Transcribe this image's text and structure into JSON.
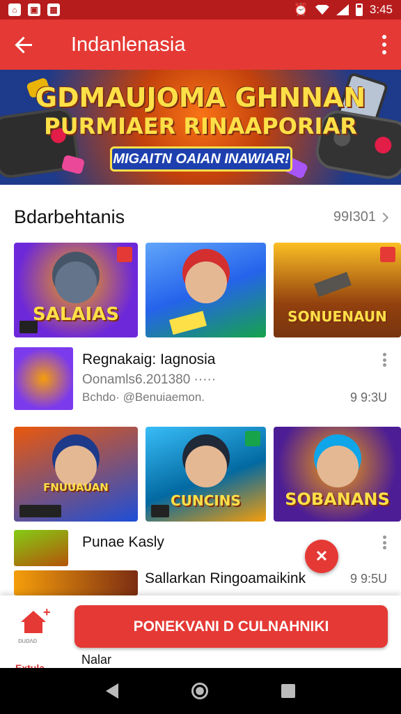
{
  "status_bar": {
    "time": "3:45"
  },
  "app_bar": {
    "title": "Indanlenasia"
  },
  "banner": {
    "line1": "GDMAUJOMA GHNNAN",
    "line2": "PURMIAER RINAAPORIAR",
    "pill": "MIGAITN OAIAN INAWIAR!"
  },
  "section": {
    "title": "Bdarbehtanis",
    "more": "99I301"
  },
  "row1_tiles": [
    {
      "label": "SALAIAS",
      "colors": [
        "#6d28d9",
        "#f59e0b"
      ]
    },
    {
      "label": "",
      "colors": [
        "#2563eb",
        "#16a34a"
      ]
    },
    {
      "label": "SONUENAUN",
      "colors": [
        "#92400e",
        "#f59e0b"
      ]
    }
  ],
  "list_item_1": {
    "title": "Regnakaig: Iagnosia",
    "subtitle": "Oonamls6.201380 ·····",
    "meta": "Bchdo· @Benuiaemon.",
    "time": "9 9:3U"
  },
  "row2_tiles": [
    {
      "label": "FNUUAUAN",
      "colors": [
        "#ea580c",
        "#1d4ed8"
      ]
    },
    {
      "label": "CUNCINS",
      "colors": [
        "#0369a1",
        "#f59e0b"
      ]
    },
    {
      "label": "SOBANANS",
      "colors": [
        "#4c1d95",
        "#16a34a"
      ]
    }
  ],
  "list_item_2": {
    "title": "Punae Kasly"
  },
  "list_item_3": {
    "title": "Sallarkan Ringoamaikink",
    "time": "9 9:5U"
  },
  "bottom_bar": {
    "home_label": "ɒuɒʌɒ",
    "cta": "PONEKVANI D CULNAHNIKI",
    "below_label": "Nalar",
    "cut_label": "Extula"
  },
  "icons": {
    "back": "back-arrow-icon",
    "more": "more-vert-icon",
    "fab": "close-x-icon",
    "home": "home-icon"
  },
  "colors": {
    "primary": "#e53935",
    "primary_dark": "#b71c1c",
    "accent_yellow": "#fde047"
  }
}
